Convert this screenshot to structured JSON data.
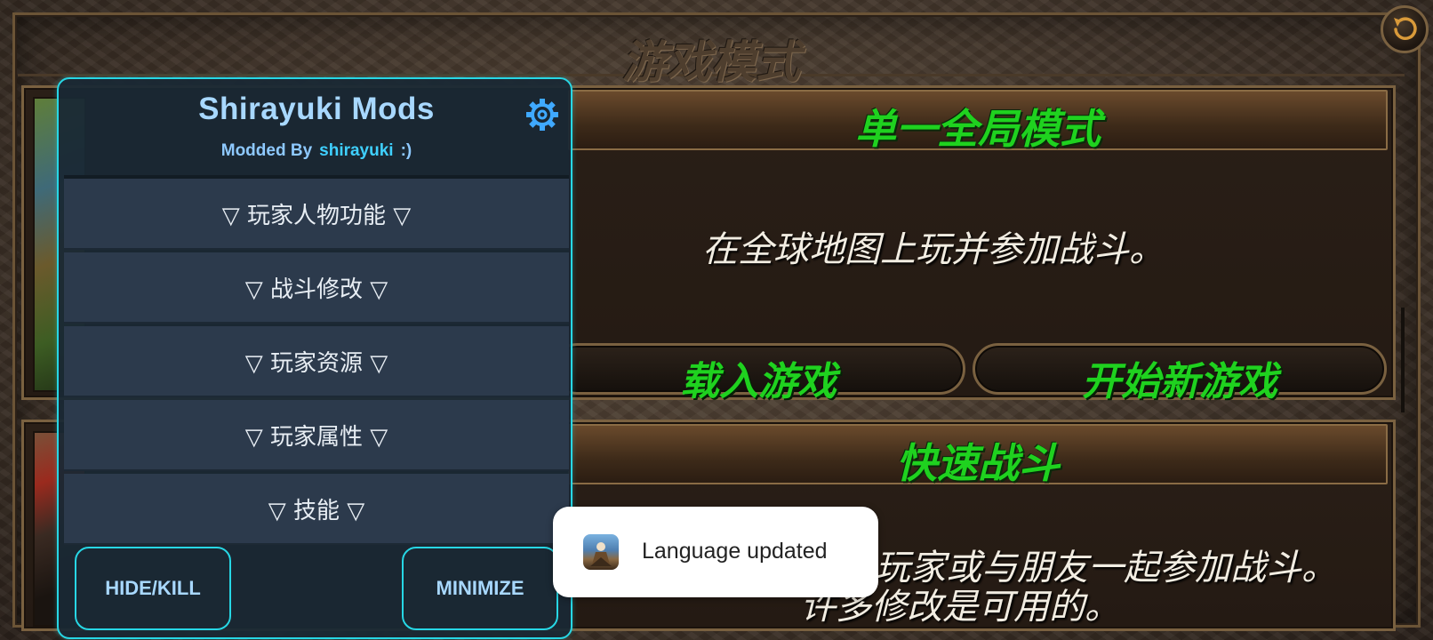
{
  "game": {
    "title": "游戏模式",
    "single_mode": {
      "banner": "单一全局模式",
      "description": "在全球地图上玩并参加战斗。",
      "load_button": "载入游戏",
      "new_button": "开始新游戏"
    },
    "quick_battle": {
      "banner": "快速战斗",
      "description_line1": "玩家或与朋友一起参加战斗。",
      "description_line2": "许多修改是可用的。"
    }
  },
  "mod_menu": {
    "title": "Shirayuki Mods",
    "subtitle_prefix": "Modded By",
    "author": "shirayuki",
    "subtitle_suffix": ":)",
    "items": [
      {
        "label": "▽ 玩家人物功能 ▽"
      },
      {
        "label": "▽ 战斗修改 ▽"
      },
      {
        "label": "▽ 玩家资源 ▽"
      },
      {
        "label": "▽ 玩家属性 ▽"
      },
      {
        "label": "▽ 技能 ▽"
      }
    ],
    "hide_button": "HIDE/KILL",
    "minimize_button": "MINIMIZE"
  },
  "toast": {
    "message": "Language updated",
    "icon": "app-icon"
  },
  "colors": {
    "accent_cyan": "#27d7e5",
    "mod_text": "#a8d8ff",
    "game_green": "#1fd21f",
    "panel_border": "#7a6140"
  }
}
